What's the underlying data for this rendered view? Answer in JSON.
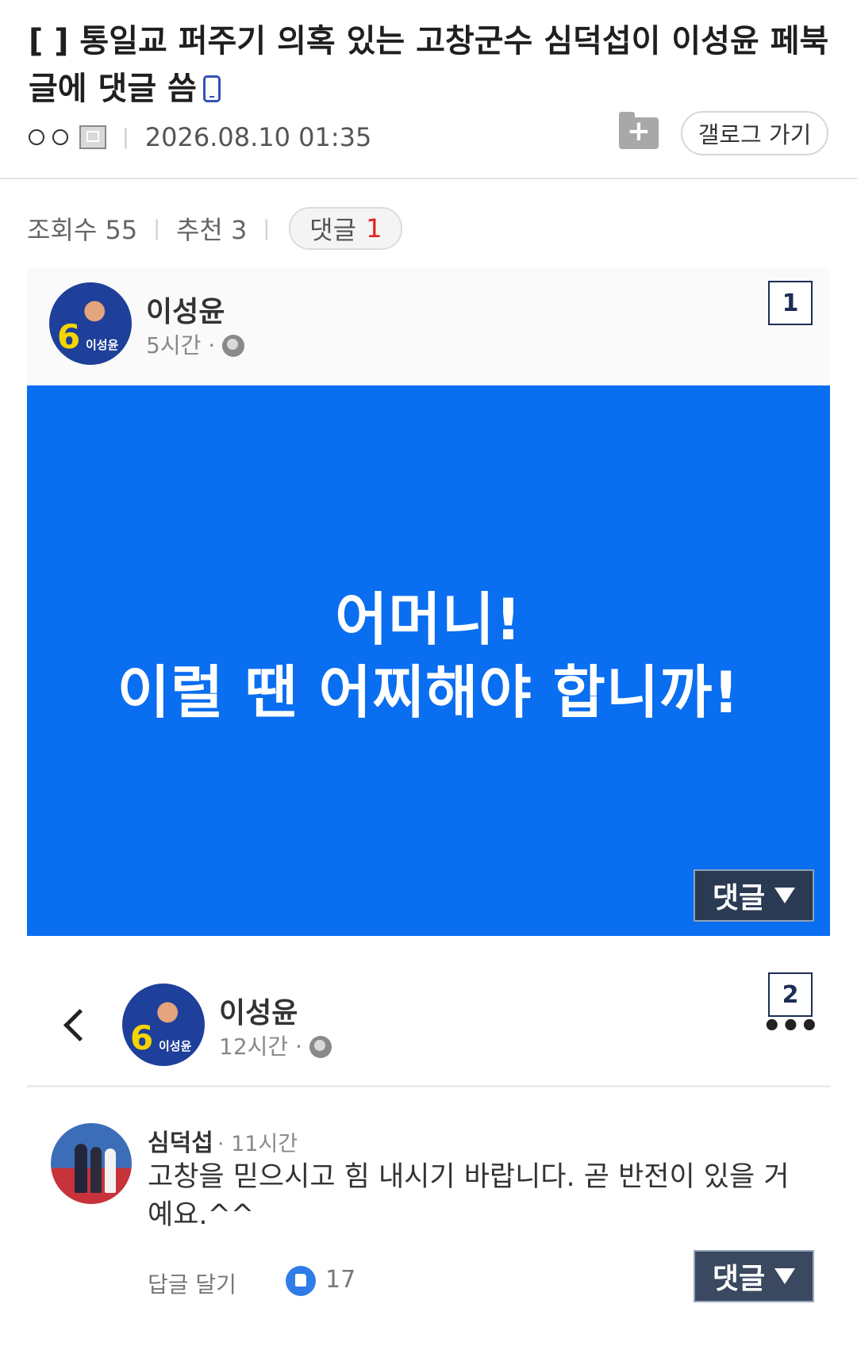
{
  "post": {
    "title": "[  ] 통일교 퍼주기 의혹 있는 고창군수 심덕섭이 이성윤 페북글에 댓글 씀",
    "datetime": "2026.08.10 01:35",
    "gallog_label": "갤로그 가기",
    "folder_add_icon": "+"
  },
  "stats": {
    "views_label": "조회수 55",
    "recommend_label": "추천 3",
    "comment_label": "댓글",
    "comment_count": "1"
  },
  "screenshot1": {
    "box_number": "1",
    "author": "이성윤",
    "time": "5시간 ·",
    "avatar_number": "6",
    "avatar_name": "이성윤",
    "panel_line1": "어머니!",
    "panel_line2": "이럴 땐 어찌해야 합니까!",
    "reply_label": "댓글",
    "panel_color": "#0a6ef0"
  },
  "screenshot2": {
    "box_number": "2",
    "author": "이성윤",
    "time": "12시간 ·",
    "avatar_number": "6",
    "avatar_name": "이성윤",
    "more_label": "•••",
    "comment": {
      "author": "심덕섭",
      "time": "· 11시간",
      "text_line1": "고창을 믿으시고 힘 내시기 바랍니다. 곧 반전이 있을 거",
      "text_line2": "예요.^^",
      "reply_link": "답글 달기",
      "like_count": "17"
    },
    "reply_label": "댓글"
  }
}
